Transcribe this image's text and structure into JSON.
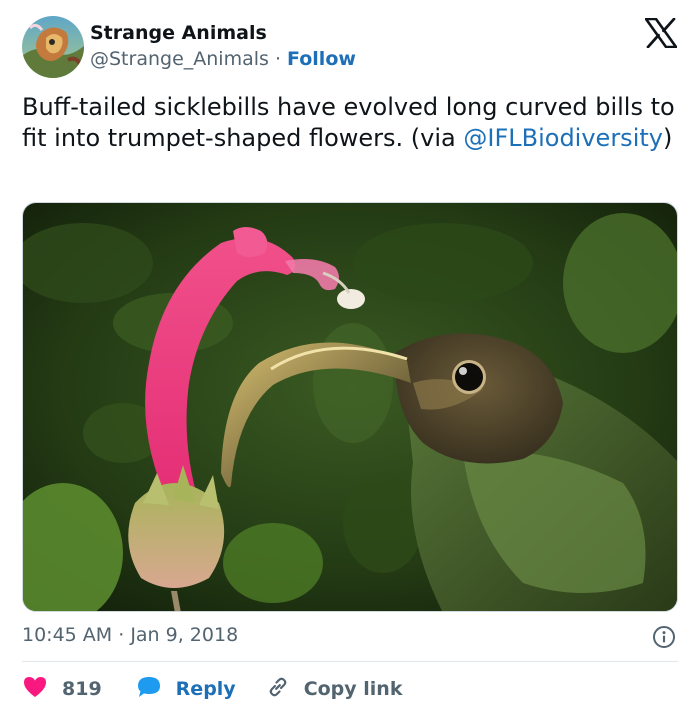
{
  "account": {
    "display_name": "Strange Animals",
    "handle": "@Strange_Animals",
    "separator": " · ",
    "follow_label": "Follow"
  },
  "platform_icon": "x-logo-icon",
  "tweet": {
    "text_before": "Buff-tailed sicklebills have evolved long curved bills to fit into trumpet-shaped flowers. (via ",
    "mention": "@IFLBiodiversity",
    "text_after": ")"
  },
  "image": {
    "subject": "sicklebill-hummingbird-with-pink-flower-photo"
  },
  "meta": {
    "time": "10:45 AM",
    "separator": " · ",
    "date": "Jan 9, 2018",
    "info_icon": "info-icon"
  },
  "actions": {
    "like_count": "819",
    "reply_label": "Reply",
    "copy_label": "Copy link"
  },
  "colors": {
    "link": "#1d6fb8",
    "like": "#f91880",
    "reply": "#1d9bf0",
    "muted": "#536471"
  }
}
